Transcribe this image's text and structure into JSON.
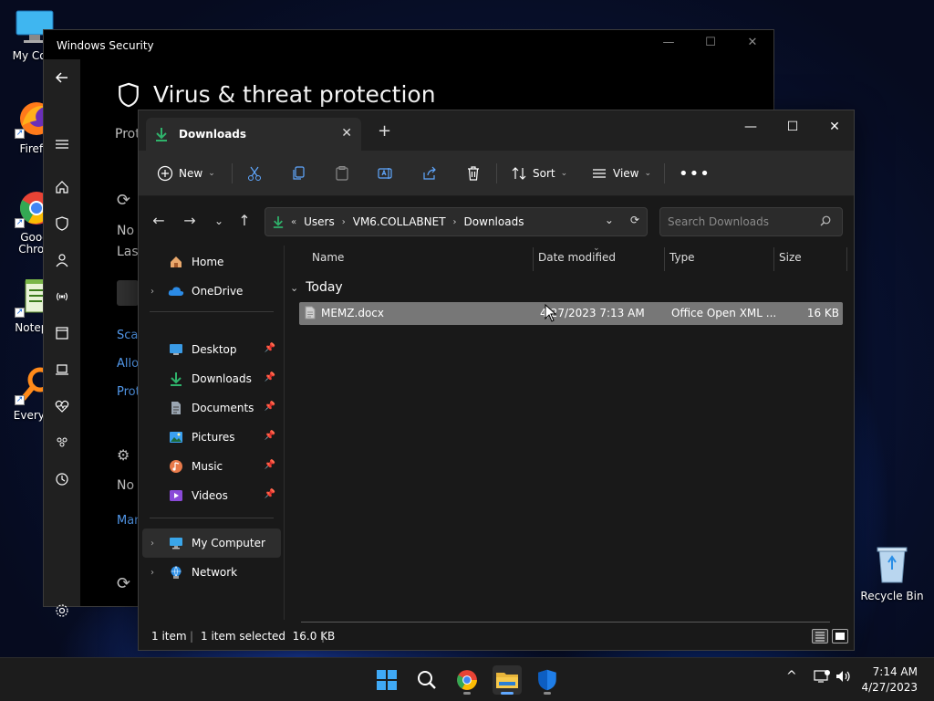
{
  "desktop": {
    "icons": [
      {
        "label": "My Com"
      },
      {
        "label": "Firefo"
      },
      {
        "label": "Goog"
      },
      {
        "label": "Chron"
      },
      {
        "label": "Notepa"
      },
      {
        "label": "Everyth"
      }
    ],
    "recycle_bin": "Recycle Bin"
  },
  "security": {
    "title": "Windows Security",
    "heading": "Virus & threat protection",
    "fragments": [
      "Prot",
      "No",
      "Last",
      "No"
    ],
    "links": [
      "Scan",
      "Allo",
      "Prot",
      "Man"
    ]
  },
  "explorer": {
    "tab_title": "Downloads",
    "toolbar": {
      "new_label": "New",
      "sort_label": "Sort",
      "view_label": "View"
    },
    "address": {
      "overflow": "«",
      "crumbs": [
        "Users",
        "VM6.COLLABNET",
        "Downloads"
      ]
    },
    "search_placeholder": "Search Downloads",
    "nav": {
      "home": "Home",
      "onedrive": "OneDrive",
      "desktop": "Desktop",
      "downloads": "Downloads",
      "documents": "Documents",
      "pictures": "Pictures",
      "music": "Music",
      "videos": "Videos",
      "my_computer": "My Computer",
      "network": "Network"
    },
    "columns": {
      "name": "Name",
      "date": "Date modified",
      "type": "Type",
      "size": "Size"
    },
    "group": "Today",
    "files": [
      {
        "name": "MEMZ.docx",
        "date": "4/27/2023 7:13 AM",
        "type": "Office Open XML ...",
        "size": "16 KB"
      }
    ],
    "status": {
      "items": "1 item",
      "selected": "1 item selected  16.0 KB"
    }
  },
  "taskbar": {
    "time": "7:14 AM",
    "date": "4/27/2023"
  },
  "colors": {
    "accent": "#0078d4",
    "folder_yellow": "#e8b53a",
    "download_green": "#2fb36b",
    "link_blue": "#5aa6ff"
  }
}
